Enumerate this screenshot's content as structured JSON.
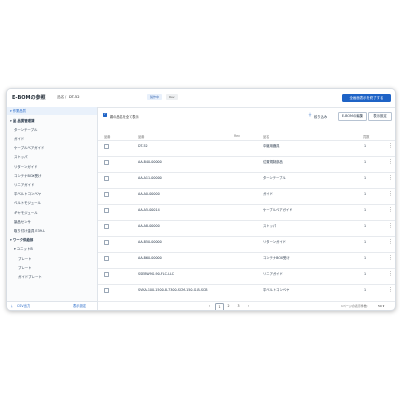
{
  "header": {
    "title": "E-BOMの参照",
    "crumb_label": "品名",
    "crumb_sep": "/",
    "crumb_value": "DT-52",
    "chip_status": "製作中",
    "chip_rev": "Rev",
    "primary_button": "全画面表示を終了する"
  },
  "sidebar": {
    "heading": "▾ 作業品質",
    "items": [
      {
        "label": "▾ 品 品質管理課",
        "level": 1
      },
      {
        "label": "ターンテーブル",
        "level": 2
      },
      {
        "label": "ガイド",
        "level": 2
      },
      {
        "label": "ケーブルベアガイド",
        "level": 2
      },
      {
        "label": "ストッパ",
        "level": 2
      },
      {
        "label": "リターンガイド",
        "level": 2
      },
      {
        "label": "コンテナBOX受け",
        "level": 2
      },
      {
        "label": "リニアガイド",
        "level": 2
      },
      {
        "label": "平ベルトコンベヤ",
        "level": 2
      },
      {
        "label": "ベルトモジュール",
        "level": 2
      },
      {
        "label": "ギヤモジュール",
        "level": 2
      },
      {
        "label": "製品センサ",
        "level": 2
      },
      {
        "label": "取り付け金具 E39-L",
        "level": 2
      },
      {
        "label": "▾ ワーク供給部",
        "level": 1
      },
      {
        "label": "▾ ユニットB",
        "level": 2
      },
      {
        "label": "プレート",
        "level": 3
      },
      {
        "label": "プレート",
        "level": 3
      },
      {
        "label": "ガイドプレート",
        "level": 3
      }
    ],
    "footer_left": "CSV出力",
    "footer_right": "表示設定"
  },
  "toolbar": {
    "checkbox_label": "親の品名を全て表示",
    "filter_label": "絞り込み",
    "bom_button": "E-BOMの編集",
    "settings_button": "表示設定"
  },
  "table": {
    "headers": [
      "品番",
      "品番",
      "Rev",
      "品名",
      "員数"
    ],
    "rows": [
      {
        "part_no": "DT-52",
        "name": "中継用器具",
        "qty": "1"
      },
      {
        "part_no": "AA-B40-00000",
        "name": "位置規制部品",
        "qty": "1"
      },
      {
        "part_no": "AA-A11-00000",
        "name": "ターンテーブル",
        "qty": "1"
      },
      {
        "part_no": "AA-A0-00000",
        "name": "ガイド",
        "qty": "1"
      },
      {
        "part_no": "AA-A5-00014",
        "name": "ケーブルベアガイド",
        "qty": "1"
      },
      {
        "part_no": "AA-A8-00000",
        "name": "ストッパ",
        "qty": "1"
      },
      {
        "part_no": "AA-B50-00000",
        "name": "リターンガイド",
        "qty": "1"
      },
      {
        "part_no": "AA-B60-00000",
        "name": "コンテナBOX受け",
        "qty": "1"
      },
      {
        "part_no": "SSEBW9G-90-FLC-LLC",
        "name": "リニアガイド",
        "qty": "1"
      },
      {
        "part_no": "SVKA-100-1500-8-7300-SCM-150-G-B-SCB",
        "name": "平ベルトコンベヤ",
        "qty": "1"
      }
    ]
  },
  "pagination": {
    "prev": "‹",
    "pages": [
      "1",
      "2",
      "3"
    ],
    "next": "›",
    "current": "1",
    "per_page_label": "1ページの表示件数:",
    "per_page_value": "50 ▾"
  },
  "colors": {
    "accent": "#1e63c6"
  }
}
